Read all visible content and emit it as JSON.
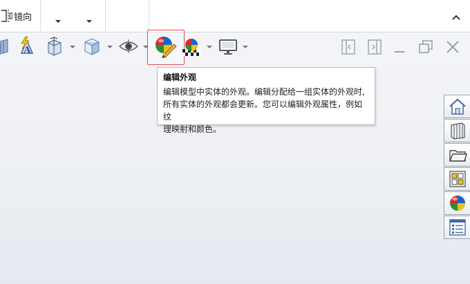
{
  "ribbon": {
    "mirror_label": "镜向"
  },
  "heads_up_toolbar": {
    "icons": [
      "section-view-icon",
      "view-orientation-icon",
      "display-style-icon",
      "hide-show-items-icon",
      "edit-appearance-icon",
      "apply-scene-icon",
      "view-settings-icon"
    ]
  },
  "tooltip": {
    "title": "编辑外观",
    "line1": "编辑模型中实体的外观。编辑分配给一组实体的外观时,",
    "line2": "所有实体的外观都会更新。您可以编辑外观属性，例如纹",
    "line3": "理映射和颜色。"
  },
  "window_controls": [
    "tile-left-icon",
    "tile-right-icon",
    "minimize-icon",
    "restore-icon",
    "close-icon"
  ],
  "task_pane": {
    "tabs": [
      "home-icon",
      "design-library-icon",
      "file-explorer-icon",
      "view-palette-icon",
      "appearances-icon",
      "custom-properties-icon"
    ]
  }
}
